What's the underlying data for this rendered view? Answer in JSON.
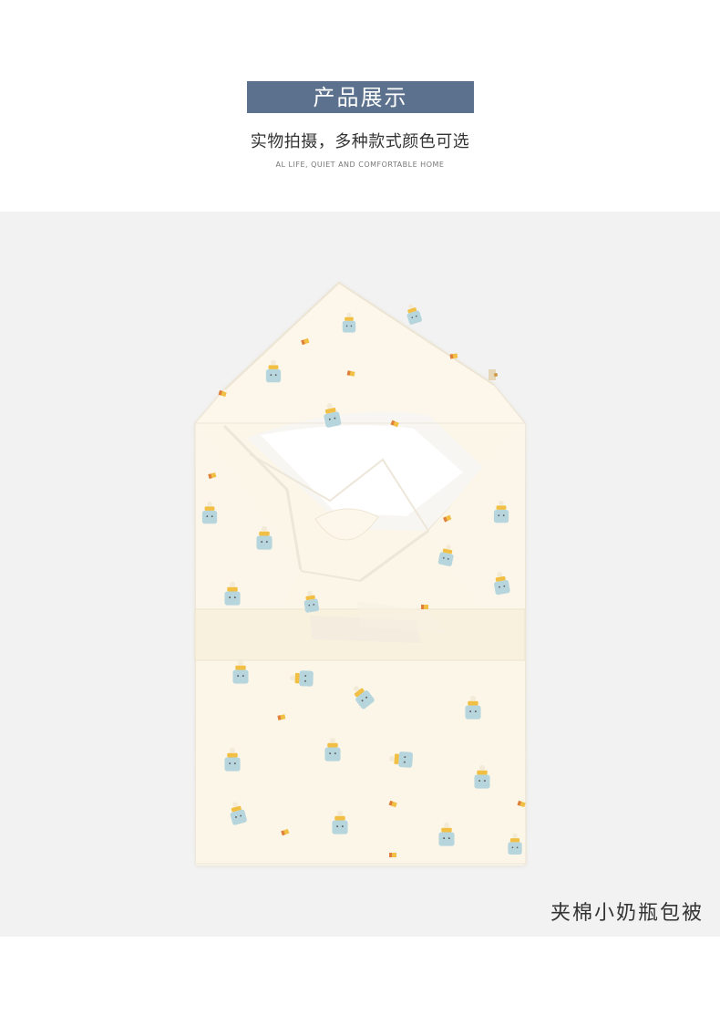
{
  "header": {
    "title": "产品展示",
    "subtitle": "实物拍摄，多种款式颜色可选",
    "tagline": "AL LIFE, QUIET AND COMFORTABLE HOME"
  },
  "product": {
    "caption": "夹棉小奶瓶包被"
  },
  "colors": {
    "title_background": "#5b718e",
    "product_background": "#f2f2f2",
    "swaddle_fabric": "#fbf6e8",
    "bottle_body": "#b7d5dd",
    "bottle_cap": "#f0bf43"
  }
}
